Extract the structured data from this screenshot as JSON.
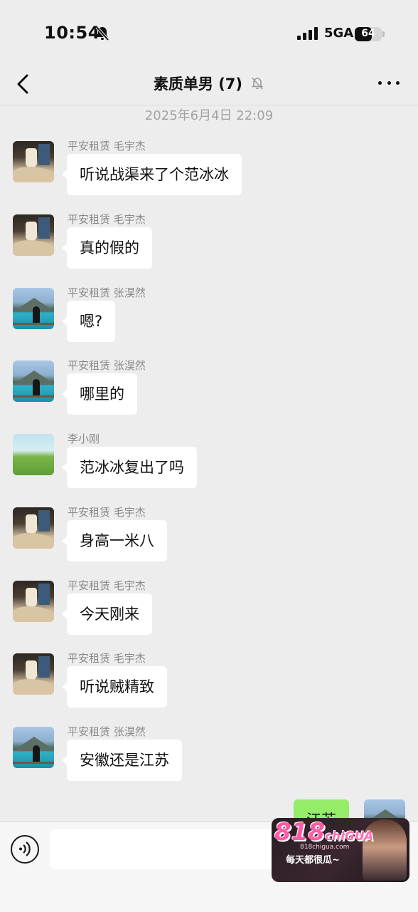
{
  "status_bar": {
    "time": "10:54",
    "network": "5GA",
    "battery": "64",
    "battery_level": 0.64
  },
  "nav": {
    "title": "素质单男 (7)"
  },
  "chat": {
    "timestamp": "2025年6月4日 22:09",
    "messages": [
      {
        "sender": "平安租赁 毛宇杰",
        "text": "听说战渠来了个范冰冰",
        "avatar": "room"
      },
      {
        "sender": "平安租赁 毛宇杰",
        "text": "真的假的",
        "avatar": "room"
      },
      {
        "sender": "平安租赁 张淏然",
        "text": "嗯?",
        "avatar": "lake"
      },
      {
        "sender": "平安租赁 张淏然",
        "text": "哪里的",
        "avatar": "lake"
      },
      {
        "sender": "李小刚",
        "text": "范冰冰复出了吗",
        "avatar": "field"
      },
      {
        "sender": "平安租赁 毛宇杰",
        "text": "身高一米八",
        "avatar": "room"
      },
      {
        "sender": "平安租赁 毛宇杰",
        "text": "今天刚来",
        "avatar": "room"
      },
      {
        "sender": "平安租赁 毛宇杰",
        "text": "听说贼精致",
        "avatar": "room"
      },
      {
        "sender": "平安租赁 张淏然",
        "text": "安徽还是江苏",
        "avatar": "lake"
      }
    ],
    "own_message": {
      "text": "江苏"
    }
  },
  "input": {
    "placeholder": ""
  },
  "promo": {
    "logo": "818",
    "logo_sub": "chiGUA",
    "site": "818chigua.com",
    "slogan": "每天都很瓜~"
  },
  "colors": {
    "background": "#ededed",
    "own_bubble": "#95ec69",
    "incoming_bubble": "#ffffff"
  }
}
